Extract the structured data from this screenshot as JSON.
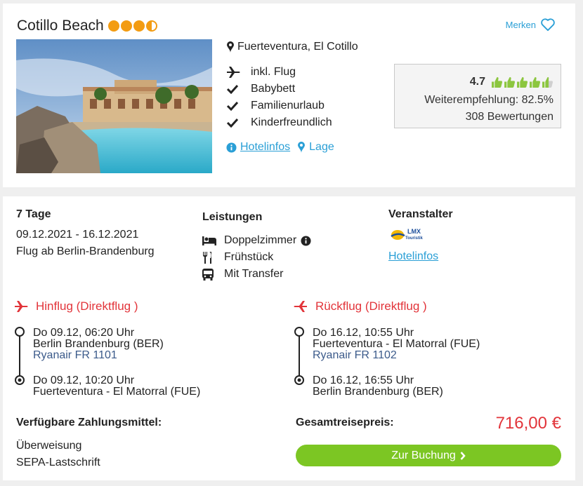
{
  "hotel": {
    "name": "Cotillo Beach",
    "stars_full": 3,
    "stars_half": 1,
    "merken_label": "Merken",
    "location": "Fuerteventura, El Cotillo",
    "features": [
      {
        "icon": "plane-icon",
        "label": "inkl. Flug"
      },
      {
        "icon": "check-icon",
        "label": "Babybett"
      },
      {
        "icon": "check-icon",
        "label": "Familienurlaub"
      },
      {
        "icon": "check-icon",
        "label": "Kinderfreundlich"
      }
    ],
    "hotelinfos_label": "Hotelinfos",
    "lage_label": "Lage",
    "rating": {
      "score": "4.7",
      "thumbs_full": 4,
      "thumbs_half": 1,
      "recommendation": "Weiterempfehlung: 82.5%",
      "reviews": "308 Bewertungen"
    }
  },
  "offer": {
    "duration": "7 Tage",
    "dates": "09.12.2021 - 16.12.2021",
    "departure": "Flug ab Berlin-Brandenburg",
    "services_title": "Leistungen",
    "services": [
      {
        "icon": "bed-icon",
        "label": "Doppelzimmer"
      },
      {
        "icon": "cutlery-icon",
        "label": "Frühstück"
      },
      {
        "icon": "bus-icon",
        "label": "Mit Transfer"
      }
    ],
    "operator_title": "Veranstalter",
    "operator_logo_text": "LMX Touristik",
    "operator_link": "Hotelinfos",
    "outbound": {
      "title": "Hinflug (Direktflug )",
      "dep_time": "Do 09.12, 06:20 Uhr",
      "dep_airport": "Berlin Brandenburg (BER)",
      "airline": "Ryanair FR 1101",
      "arr_time": "Do 09.12, 10:20 Uhr",
      "arr_airport": "Fuerteventura - El Matorral (FUE)"
    },
    "return": {
      "title": "Rückflug (Direktflug )",
      "dep_time": "Do 16.12, 10:55 Uhr",
      "dep_airport": "Fuerteventura - El Matorral (FUE)",
      "airline": "Ryanair FR 1102",
      "arr_time": "Do 16.12, 16:55 Uhr",
      "arr_airport": "Berlin Brandenburg (BER)"
    },
    "payment_title": "Verfügbare Zahlungsmittel:",
    "payments": [
      "Überweisung",
      "SEPA-Lastschrift"
    ],
    "price_label": "Gesamtreisepreis:",
    "price": "716,00 €",
    "book_label": "Zur Buchung"
  },
  "colors": {
    "accent_blue": "#2a9fd6",
    "accent_red": "#e2343a",
    "accent_green": "#7cc623",
    "star_orange": "#f39c12",
    "thumb_green": "#8cc63f"
  }
}
